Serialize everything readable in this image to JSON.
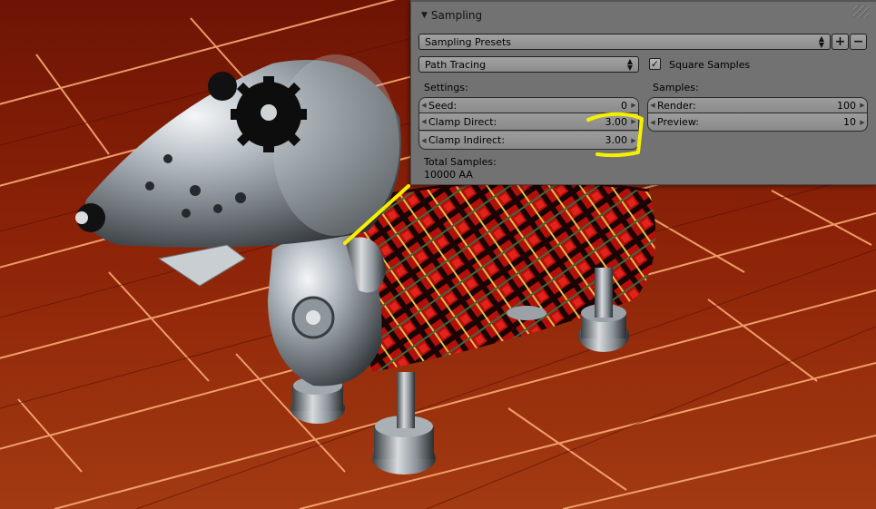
{
  "panel": {
    "title": "Sampling",
    "presets_label": "Sampling Presets",
    "add_symbol": "+",
    "remove_symbol": "−",
    "integrator": "Path Tracing",
    "square_samples": {
      "label": "Square Samples",
      "checked": true
    },
    "settings": {
      "heading": "Settings:",
      "fields": [
        {
          "label": "Seed:",
          "value": "0"
        },
        {
          "label": "Clamp Direct:",
          "value": "3.00"
        },
        {
          "label": "Clamp Indirect:",
          "value": "3.00"
        }
      ]
    },
    "samples": {
      "heading": "Samples:",
      "fields": [
        {
          "label": "Render:",
          "value": "100"
        },
        {
          "label": "Preview:",
          "value": "10"
        }
      ]
    },
    "total": {
      "label": "Total Samples:",
      "value": "10000 AA"
    }
  },
  "colors": {
    "panel_bg": "#727272",
    "annotation": "#f5f000",
    "floor": "#8a1c06",
    "floor_glow": "#ff6a2a",
    "tartan_red": "#c4120f"
  }
}
